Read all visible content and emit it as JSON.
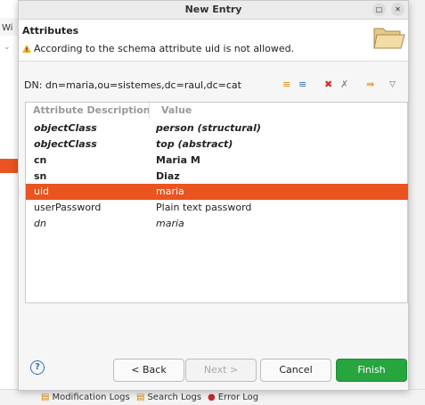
{
  "background": {
    "left_text": "Wi",
    "tabs": [
      {
        "label": "Modification Logs"
      },
      {
        "label": "Search Logs"
      },
      {
        "label": "Error Log"
      }
    ]
  },
  "dialog": {
    "title": "New Entry",
    "header": {
      "title": "Attributes",
      "message": "According to the schema attribute uid is not allowed."
    },
    "dn": "DN: dn=maria,ou=sistemes,dc=raul,dc=cat",
    "table": {
      "columns": [
        "Attribute Description",
        "Value"
      ],
      "rows": [
        {
          "attr": "objectClass",
          "value": "person (structural)",
          "style": "bold-italic"
        },
        {
          "attr": "objectClass",
          "value": "top (abstract)",
          "style": "bold-italic"
        },
        {
          "attr": "cn",
          "value": "Maria M",
          "style": "bold"
        },
        {
          "attr": "sn",
          "value": "Diaz",
          "style": "bold"
        },
        {
          "attr": "uid",
          "value": "maria",
          "style": "selected"
        },
        {
          "attr": "userPassword",
          "value": "Plain text password",
          "style": "normal"
        },
        {
          "attr": "dn",
          "value": "maria",
          "style": "italic"
        }
      ]
    },
    "buttons": {
      "back": "< Back",
      "next": "Next >",
      "cancel": "Cancel",
      "finish": "Finish"
    }
  },
  "colors": {
    "selection": "#e95420",
    "finish": "#27a53e",
    "help": "#2f6fb5"
  }
}
